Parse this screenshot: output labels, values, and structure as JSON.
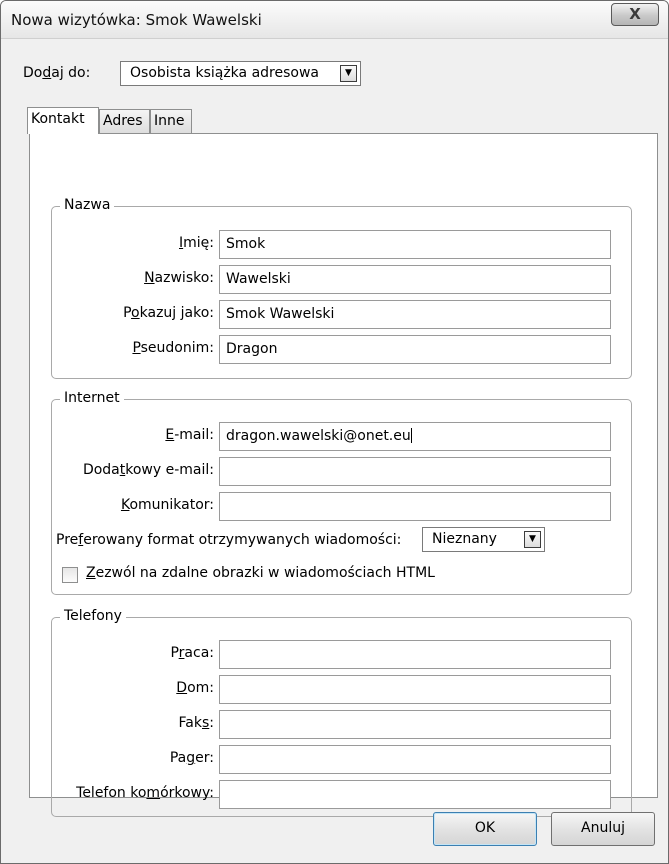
{
  "window": {
    "title": "Nowa wizytówka: Smok Wawelski",
    "close_label": "X"
  },
  "add_to": {
    "label_a": "Dodaj do:",
    "label_pre": "Do",
    "label_u": "d",
    "label_post": "aj do:",
    "value": "Osobista książka adresowa"
  },
  "tabs": [
    "Kontakt",
    "Adres",
    "Inne"
  ],
  "name_group": {
    "legend": "Nazwa",
    "fields": [
      {
        "pre": "",
        "u": "I",
        "post": "mię:",
        "value": "Smok"
      },
      {
        "pre": "",
        "u": "N",
        "post": "azwisko:",
        "value": "Wawelski"
      },
      {
        "pre": "P",
        "u": "o",
        "post": "kazuj jako:",
        "value": "Smok Wawelski"
      },
      {
        "pre": "",
        "u": "P",
        "post": "seudonim:",
        "value": "Dragon"
      }
    ]
  },
  "internet_group": {
    "legend": "Internet",
    "fields": [
      {
        "pre": "",
        "u": "E",
        "post": "-mail:",
        "value": "dragon.wawelski@onet.eu"
      },
      {
        "pre": "Doda",
        "u": "t",
        "post": "kowy e-mail:",
        "value": ""
      },
      {
        "pre": "",
        "u": "K",
        "post": "omunikator:",
        "value": ""
      }
    ],
    "format_pre": "Pre",
    "format_u": "f",
    "format_post": "erowany format otrzymywanych wiadomości:",
    "format_value": "Nieznany",
    "remote_images_u": "Z",
    "remote_images_post": "ezwól na zdalne obrazki w wiadomościach HTML",
    "remote_images_checked": false
  },
  "phones_group": {
    "legend": "Telefony",
    "fields": [
      {
        "pre": "P",
        "u": "r",
        "post": "aca:",
        "value": ""
      },
      {
        "pre": "",
        "u": "D",
        "post": "om:",
        "value": ""
      },
      {
        "pre": "Fak",
        "u": "s",
        "post": ":",
        "value": ""
      },
      {
        "pre": "Pa",
        "u": "g",
        "post": "er:",
        "value": ""
      },
      {
        "pre": "Telefon ko",
        "u": "m",
        "post": "órkowy:",
        "value": ""
      }
    ]
  },
  "buttons": {
    "ok": "OK",
    "cancel": "Anuluj"
  }
}
